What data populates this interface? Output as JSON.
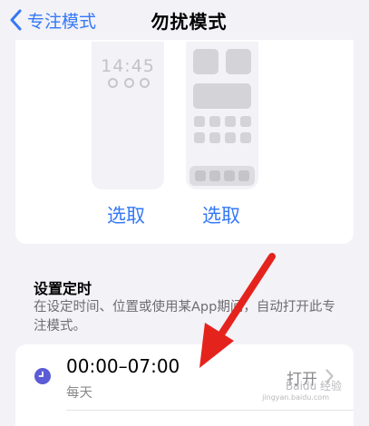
{
  "nav": {
    "back_label": "专注模式",
    "title": "勿扰模式"
  },
  "previews": {
    "lock_screen_time": "14:45",
    "lock_pick_label": "选取",
    "home_pick_label": "选取"
  },
  "schedule_section": {
    "heading": "设置定时",
    "description": "在设定时间、位置或使用某App期间，自动打开此专注模式。"
  },
  "schedule_item": {
    "time_range": "00:00–07:00",
    "repeat": "每天",
    "state": "打开"
  },
  "watermark": {
    "text": "Baidu 经验",
    "sub": "jingyan.baidu.com"
  },
  "colors": {
    "accent": "#3478f6",
    "arrow": "#e5231d",
    "clock_icon": "#5b5bd6"
  }
}
